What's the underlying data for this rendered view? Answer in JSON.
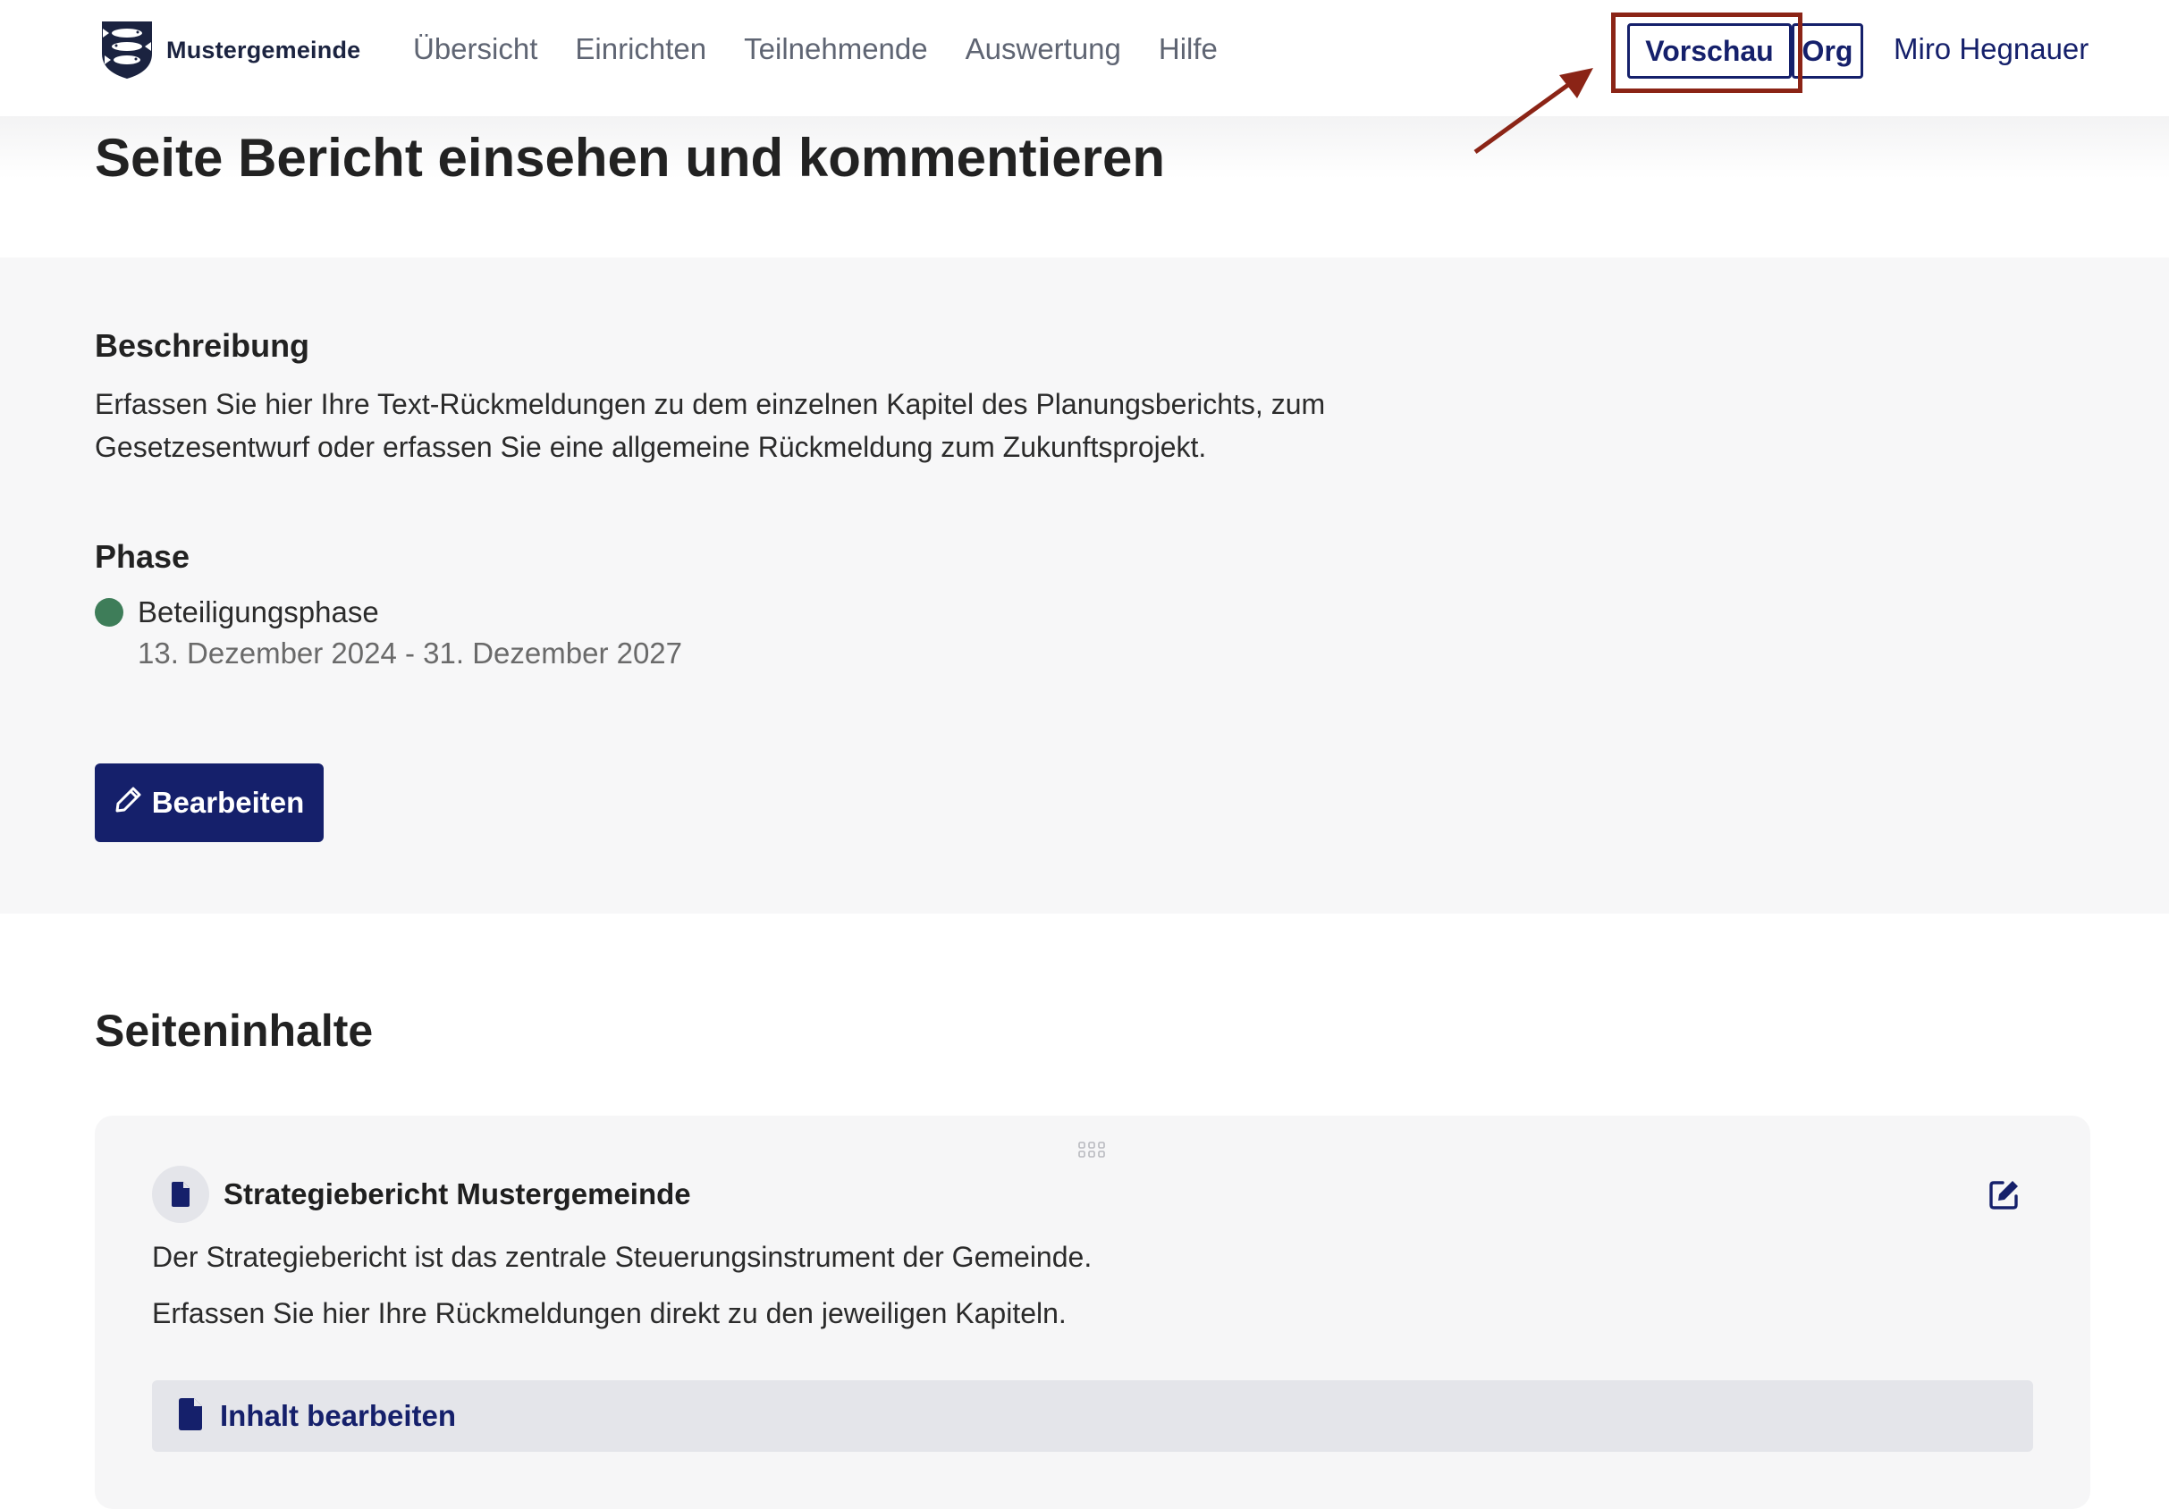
{
  "header": {
    "logo_text": "Mustergemeinde",
    "nav": [
      {
        "label": "Übersicht"
      },
      {
        "label": "Einrichten"
      },
      {
        "label": "Teilnehmende"
      },
      {
        "label": "Auswertung"
      },
      {
        "label": "Hilfe"
      }
    ],
    "preview_label": "Vorschau",
    "org_label": "Org",
    "user_name": "Miro Hegnauer"
  },
  "page": {
    "title": "Seite Bericht einsehen und kommentieren"
  },
  "info": {
    "description_heading": "Beschreibung",
    "description_text": "Erfassen Sie hier Ihre Text-Rückmeldungen zu dem einzelnen Kapitel des Planungsberichts, zum Gesetzesentwurf oder erfassen Sie eine allgemeine Rückmeldung zum Zukunftsprojekt.",
    "phase_heading": "Phase",
    "phase_name": "Beteiligungsphase",
    "phase_dates": "13. Dezember 2024 - 31. Dezember 2027",
    "edit_label": "Bearbeiten"
  },
  "content": {
    "heading": "Seiteninhalte",
    "card": {
      "title": "Strategiebericht Mustergemeinde",
      "line1": "Der Strategiebericht ist das zentrale Steuerungsinstrument der Gemeinde.",
      "line2": "Erfassen Sie hier Ihre Rückmeldungen direkt zu den jeweiligen Kapiteln.",
      "action_label": "Inhalt bearbeiten"
    }
  },
  "colors": {
    "primary": "#15206b",
    "phase_active": "#3e7d59",
    "annotation": "#8b2416"
  },
  "icons": {
    "logo": "coat-of-arms-icon",
    "edit": "pencil-icon",
    "document": "document-icon",
    "card_edit": "edit-square-icon",
    "drag": "drag-handle-icon"
  }
}
